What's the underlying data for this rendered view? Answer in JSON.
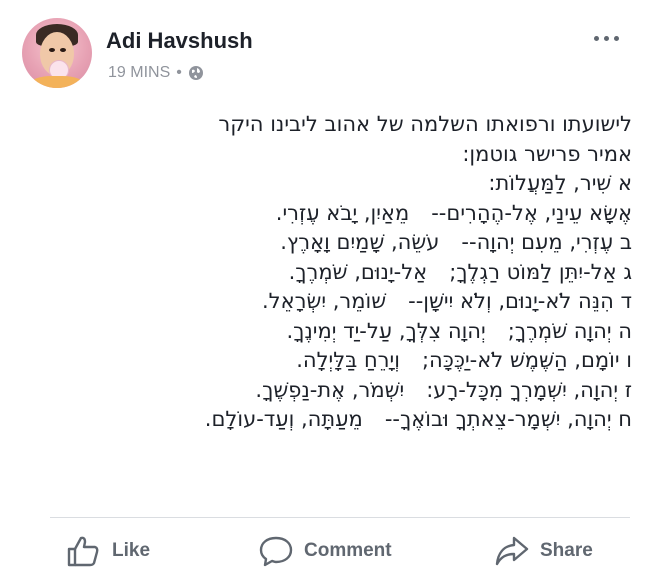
{
  "post": {
    "author": "Adi Havshush",
    "timestamp": "19 MINS",
    "privacy_icon": "globe-icon",
    "more_icon": "more-options-icon",
    "lines": [
      "לישועתו ורפואתו השלמה של אהוב ליבינו היקר",
      "אמיר פרישר גוטמן:",
      "א שִׁיר, לַמַּעֲלוֹת:",
      [
        "אֶשָּׂא עֵינַי, אֶל-הֶהָרִים--",
        "מֵאַיִן, יָבֹא עֶזְרִי."
      ],
      [
        "ב עֶזְרִי, מֵעִם יְהוָה--",
        "עֹשֵׂה, שָׁמַיִם וָאָרֶץ."
      ],
      [
        "ג אַל-יִתֵּן לַמּוֹט רַגְלֶךָ;",
        "אַל-יָנוּם, שֹׁמְרֶךָ."
      ],
      [
        "ד הִנֵּה לֹא-יָנוּם, וְלֹא יִישָׁן--",
        "שׁוֹמֵר, יִשְׂרָאֵל."
      ],
      [
        "ה יְהוָה שֹׁמְרֶךָ;",
        "יְהוָה צִלְּךָ, עַל-יַד יְמִינֶךָ."
      ],
      [
        "ו יוֹמָם, הַשֶּׁמֶשׁ לֹא-יַכֶּכָּה;",
        "וְיָרֵחַ בַּלָּיְלָה."
      ],
      [
        "ז יְהוָה, יִשְׁמָרְךָ מִכָּל-רָע:",
        "יִשְׁמֹר, אֶת-נַפְשֶׁךָ."
      ],
      [
        "ח יְהוָה, יִשְׁמָר-צֵאתְךָ וּבוֹאֶךָ--",
        "מֵעַתָּה, וְעַד-עוֹלָם."
      ]
    ]
  },
  "actions": {
    "like": {
      "label": "Like",
      "icon": "thumbs-up-icon"
    },
    "comment": {
      "label": "Comment",
      "icon": "comment-icon"
    },
    "share": {
      "label": "Share",
      "icon": "share-icon"
    }
  },
  "colors": {
    "text": "#1d2129",
    "secondary": "#90949c",
    "action": "#606770",
    "divider": "#dadde1"
  }
}
